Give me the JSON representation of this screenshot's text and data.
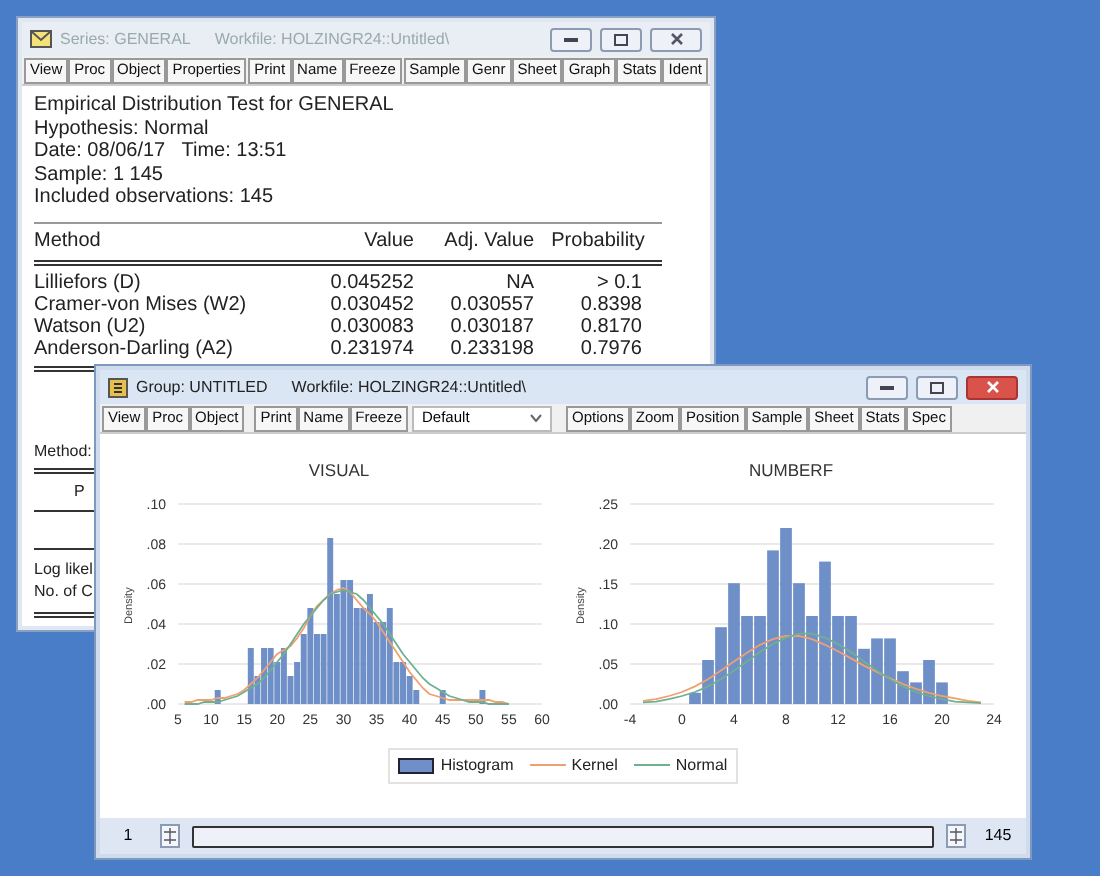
{
  "series_window": {
    "title": "Series: GENERAL",
    "workfile": "Workfile: HOLZINGR24::Untitled\\",
    "active": false,
    "toolbar": [
      {
        "kind": "button",
        "label": "View"
      },
      {
        "kind": "button",
        "label": "Proc"
      },
      {
        "kind": "button",
        "label": "Object"
      },
      {
        "kind": "button",
        "label": "Properties"
      },
      {
        "kind": "separator"
      },
      {
        "kind": "button",
        "label": "Print"
      },
      {
        "kind": "button",
        "label": "Name"
      },
      {
        "kind": "button",
        "label": "Freeze"
      },
      {
        "kind": "separator"
      },
      {
        "kind": "button",
        "label": "Sample"
      },
      {
        "kind": "button",
        "label": "Genr"
      },
      {
        "kind": "button",
        "label": "Sheet"
      },
      {
        "kind": "button",
        "label": "Graph"
      },
      {
        "kind": "button",
        "label": "Stats"
      },
      {
        "kind": "button",
        "label": "Ident"
      }
    ],
    "header_lines": [
      "Empirical Distribution Test for GENERAL",
      "Hypothesis: Normal",
      "Date: 08/06/17   Time: 13:51",
      "Sample: 1 145",
      "Included observations: 145"
    ],
    "table": {
      "columns": [
        "Method",
        "Value",
        "Adj. Value",
        "Probability"
      ],
      "rows": [
        [
          "Lilliefors (D)",
          "0.045252",
          "NA",
          "> 0.1"
        ],
        [
          "Cramer-von Mises (W2)",
          "0.030452",
          "0.030557",
          "0.8398"
        ],
        [
          "Watson (U2)",
          "0.030083",
          "0.030187",
          "0.8170"
        ],
        [
          "Anderson-Darling (A2)",
          "0.231974",
          "0.233198",
          "0.7976"
        ]
      ]
    },
    "lower_lines": [
      {
        "kind": "left",
        "text": "Method:"
      },
      {
        "kind": "center",
        "text": "P"
      },
      {
        "kind": "left",
        "text": "Log likel"
      },
      {
        "kind": "left",
        "text": "No. of C"
      }
    ]
  },
  "group_window": {
    "title": "Group: UNTITLED",
    "workfile": "Workfile: HOLZINGR24::Untitled\\",
    "active": true,
    "toolbar": [
      {
        "kind": "button",
        "label": "View"
      },
      {
        "kind": "button",
        "label": "Proc"
      },
      {
        "kind": "button",
        "label": "Object"
      },
      {
        "kind": "separator"
      },
      {
        "kind": "button",
        "label": "Print"
      },
      {
        "kind": "button",
        "label": "Name"
      },
      {
        "kind": "button",
        "label": "Freeze"
      },
      {
        "kind": "dropdown",
        "label": "Default"
      },
      {
        "kind": "separator"
      },
      {
        "kind": "button",
        "label": "Options"
      },
      {
        "kind": "button",
        "label": "Zoom"
      },
      {
        "kind": "button",
        "label": "Position"
      },
      {
        "kind": "button",
        "label": "Sample"
      },
      {
        "kind": "button",
        "label": "Sheet"
      },
      {
        "kind": "button",
        "label": "Stats"
      },
      {
        "kind": "button",
        "label": "Spec"
      }
    ],
    "charts": [
      {
        "chart_data": {
          "type": "bar",
          "grid": true,
          "title": "VISUAL",
          "ylabel": "Density",
          "xlim": [
            5,
            60
          ],
          "ylim": [
            0,
            0.1
          ],
          "xticks": [
            5,
            10,
            15,
            20,
            25,
            30,
            35,
            40,
            45,
            50,
            55,
            60
          ],
          "yticks": [
            {
              "value": 0,
              "label": ".00"
            },
            {
              "value": 0.02,
              "label": ".02"
            },
            {
              "value": 0.04,
              "label": ".04"
            },
            {
              "value": 0.06,
              "label": ".06"
            },
            {
              "value": 0.08,
              "label": ".08"
            },
            {
              "value": 0.1,
              "label": ".10"
            }
          ],
          "x": [
            6,
            7,
            8,
            9,
            10,
            11,
            12,
            13,
            14,
            15,
            16,
            17,
            18,
            19,
            20,
            21,
            22,
            23,
            24,
            25,
            26,
            27,
            28,
            29,
            30,
            31,
            32,
            33,
            34,
            35,
            36,
            37,
            38,
            39,
            40,
            41,
            42,
            43,
            44,
            45,
            46,
            47,
            48,
            49,
            50,
            51,
            52,
            53,
            54,
            55
          ],
          "series": [
            {
              "name": "Histogram",
              "type": "bar",
              "color": "#6f8fc9",
              "values": [
                null,
                null,
                null,
                null,
                null,
                0.007,
                null,
                null,
                null,
                null,
                0.028,
                0.014,
                0.028,
                0.028,
                0.021,
                0.028,
                0.014,
                0.021,
                0.035,
                0.048,
                0.035,
                0.035,
                0.083,
                0.055,
                0.062,
                0.062,
                0.048,
                0.048,
                0.055,
                0.041,
                0.041,
                0.048,
                0.021,
                0.021,
                0.014,
                0.007,
                null,
                null,
                null,
                0.007,
                null,
                null,
                null,
                null,
                null,
                0.007,
                null,
                null,
                null,
                null
              ]
            },
            {
              "name": "Kernel",
              "type": "line",
              "color": "#f0a070",
              "values": [
                0.001,
                0.001,
                0.002,
                0.002,
                0.002,
                0.003,
                0.003,
                0.004,
                0.005,
                0.007,
                0.01,
                0.013,
                0.017,
                0.021,
                0.025,
                0.027,
                0.029,
                0.033,
                0.038,
                0.044,
                0.049,
                0.052,
                0.055,
                0.057,
                0.058,
                0.056,
                0.052,
                0.048,
                0.045,
                0.041,
                0.036,
                0.031,
                0.026,
                0.021,
                0.016,
                0.012,
                0.008,
                0.005,
                0.004,
                0.003,
                0.002,
                0.002,
                0.002,
                0.002,
                0.002,
                0.002,
                0.002,
                0.001,
                0.001,
                0.0
              ]
            },
            {
              "name": "Normal",
              "type": "line",
              "color": "#6fb08f",
              "values": [
                0.0,
                0.0,
                0.0,
                0.001,
                0.001,
                0.001,
                0.002,
                0.003,
                0.004,
                0.006,
                0.008,
                0.01,
                0.013,
                0.017,
                0.021,
                0.025,
                0.03,
                0.035,
                0.04,
                0.044,
                0.048,
                0.052,
                0.055,
                0.056,
                0.057,
                0.056,
                0.055,
                0.052,
                0.048,
                0.044,
                0.04,
                0.035,
                0.03,
                0.025,
                0.021,
                0.017,
                0.013,
                0.01,
                0.008,
                0.006,
                0.004,
                0.003,
                0.002,
                0.001,
                0.001,
                0.001,
                0.0,
                0.0,
                0.0,
                0.0
              ]
            }
          ]
        }
      },
      {
        "chart_data": {
          "type": "bar",
          "grid": true,
          "title": "NUMBERF",
          "ylabel": "Density",
          "xlim": [
            -4,
            24
          ],
          "ylim": [
            0,
            0.25
          ],
          "xticks": [
            -4,
            0,
            4,
            8,
            12,
            16,
            20,
            24
          ],
          "yticks": [
            {
              "value": 0,
              "label": ".00"
            },
            {
              "value": 0.05,
              "label": ".05"
            },
            {
              "value": 0.1,
              "label": ".10"
            },
            {
              "value": 0.15,
              "label": ".15"
            },
            {
              "value": 0.2,
              "label": ".20"
            },
            {
              "value": 0.25,
              "label": ".25"
            }
          ],
          "x": [
            -3,
            -2,
            -1,
            0,
            1,
            2,
            3,
            4,
            5,
            6,
            7,
            8,
            9,
            10,
            11,
            12,
            13,
            14,
            15,
            16,
            17,
            18,
            19,
            20,
            21,
            22,
            23
          ],
          "series": [
            {
              "type": "bar",
              "color": "#6f8fc9",
              "values": [
                null,
                null,
                null,
                null,
                0.014,
                0.055,
                0.096,
                0.151,
                0.11,
                0.11,
                0.192,
                0.22,
                0.151,
                0.11,
                0.178,
                0.11,
                0.11,
                0.069,
                0.082,
                0.082,
                0.041,
                0.027,
                0.055,
                0.027,
                null,
                null,
                null
              ]
            },
            {
              "type": "line",
              "color": "#f0a070",
              "values": [
                0.004,
                0.006,
                0.01,
                0.015,
                0.022,
                0.031,
                0.042,
                0.053,
                0.064,
                0.074,
                0.081,
                0.085,
                0.085,
                0.081,
                0.074,
                0.066,
                0.057,
                0.048,
                0.04,
                0.032,
                0.025,
                0.019,
                0.014,
                0.01,
                0.007,
                0.004,
                0.002
              ]
            },
            {
              "type": "line",
              "color": "#6fb08f",
              "values": [
                0.002,
                0.003,
                0.006,
                0.01,
                0.015,
                0.022,
                0.031,
                0.042,
                0.053,
                0.065,
                0.075,
                0.083,
                0.088,
                0.088,
                0.083,
                0.075,
                0.065,
                0.053,
                0.042,
                0.031,
                0.022,
                0.015,
                0.01,
                0.006,
                0.003,
                0.002,
                0.001
              ]
            }
          ]
        }
      }
    ],
    "scroll_start": "1",
    "scroll_end": "145"
  }
}
